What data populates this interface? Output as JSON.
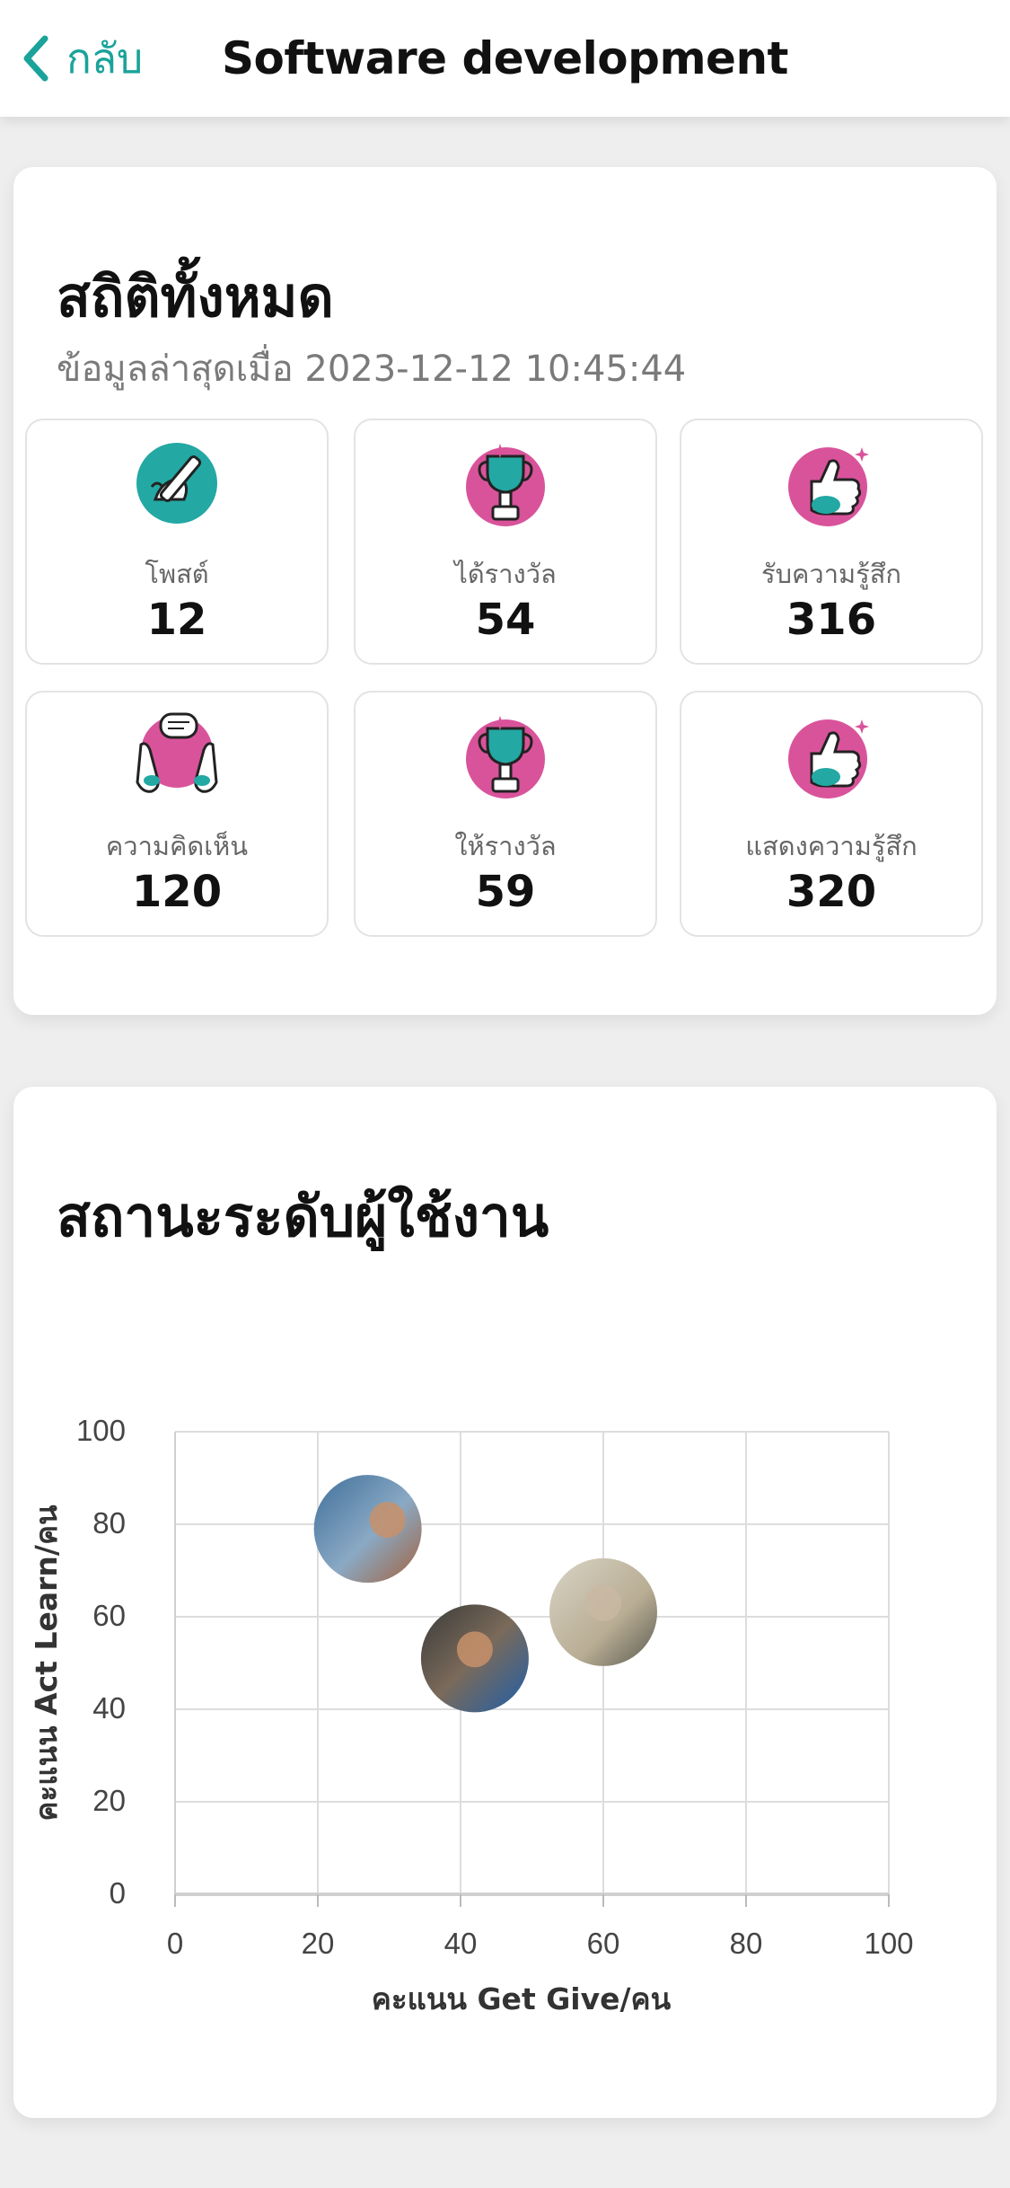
{
  "header": {
    "back_label": "กลับ",
    "title": "Software development"
  },
  "stats": {
    "title": "สถิติทั้งหมด",
    "updated": "ข้อมูลล่าสุดเมื่อ 2023-12-12 10:45:44",
    "items": [
      {
        "icon": "post-pen-icon",
        "label": "โพสต์",
        "value": "12"
      },
      {
        "icon": "trophy-received-icon",
        "label": "ได้รางวัล",
        "value": "54"
      },
      {
        "icon": "thumbs-up-received-icon",
        "label": "รับความรู้สึก",
        "value": "316"
      },
      {
        "icon": "comment-hands-icon",
        "label": "ความคิดเห็น",
        "value": "120"
      },
      {
        "icon": "trophy-given-icon",
        "label": "ให้รางวัล",
        "value": "59"
      },
      {
        "icon": "thumbs-up-given-icon",
        "label": "แสดงความรู้สึก",
        "value": "320"
      }
    ]
  },
  "colors": {
    "accent": "#1aa39a",
    "pink": "#d9539b",
    "teal": "#23a8a4"
  },
  "chart_section": {
    "title": "สถานะระดับผู้ใช้งาน"
  },
  "chart_data": {
    "type": "scatter",
    "xlabel": "คะแนน Get Give/คน",
    "ylabel": "คะแนน Act Learn/คน",
    "xlim": [
      0,
      100
    ],
    "ylim": [
      0,
      100
    ],
    "xticks": [
      "0",
      "20",
      "40",
      "60",
      "80",
      "100"
    ],
    "yticks": [
      "0",
      "20",
      "40",
      "60",
      "80",
      "100"
    ],
    "grid": true,
    "points": [
      {
        "x": 27,
        "y": 79,
        "marker": "avatar-photo"
      },
      {
        "x": 42,
        "y": 51,
        "marker": "avatar-photo"
      },
      {
        "x": 60,
        "y": 61,
        "marker": "avatar-photo"
      }
    ]
  }
}
